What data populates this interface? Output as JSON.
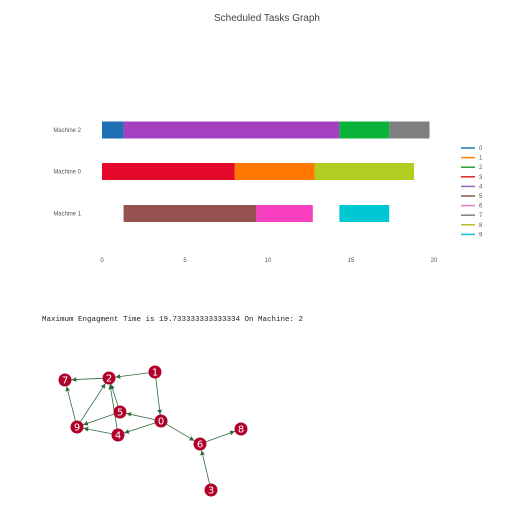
{
  "chart_data": [
    {
      "type": "gantt",
      "title": "Scheduled Tasks Graph",
      "xlabel": "",
      "ylabel": "",
      "xlim": [
        0,
        20
      ],
      "x_ticks": [
        0,
        5,
        10,
        15,
        20
      ],
      "rows": [
        "Machine 1",
        "Machine 0",
        "Machine 2"
      ],
      "legend": {
        "placement": "right",
        "entries": [
          {
            "label": "0",
            "color": "#1f77b4"
          },
          {
            "label": "1",
            "color": "#ff7f0e"
          },
          {
            "label": "2",
            "color": "#2ca02c"
          },
          {
            "label": "3",
            "color": "#d62728"
          },
          {
            "label": "4",
            "color": "#9467bd"
          },
          {
            "label": "5",
            "color": "#8c564b"
          },
          {
            "label": "6",
            "color": "#e377c2"
          },
          {
            "label": "7",
            "color": "#7f7f7f"
          },
          {
            "label": "8",
            "color": "#bcbd22"
          },
          {
            "label": "9",
            "color": "#17becf"
          }
        ]
      },
      "tasks": [
        {
          "row": "Machine 2",
          "start": 0.0,
          "end": 1.3,
          "color": "#1f6fb4"
        },
        {
          "row": "Machine 2",
          "start": 1.3,
          "end": 14.3,
          "color": "#a340c0"
        },
        {
          "row": "Machine 2",
          "start": 14.3,
          "end": 17.3,
          "color": "#09b33a"
        },
        {
          "row": "Machine 2",
          "start": 17.3,
          "end": 19.73,
          "color": "#7f7f7f"
        },
        {
          "row": "Machine 0",
          "start": 0.0,
          "end": 8.0,
          "color": "#e60a2a"
        },
        {
          "row": "Machine 0",
          "start": 8.0,
          "end": 12.8,
          "color": "#ff7700"
        },
        {
          "row": "Machine 0",
          "start": 12.8,
          "end": 18.8,
          "color": "#b2cc22"
        },
        {
          "row": "Machine 1",
          "start": 1.3,
          "end": 9.3,
          "color": "#955250"
        },
        {
          "row": "Machine 1",
          "start": 9.3,
          "end": 12.7,
          "color": "#f73fc0"
        },
        {
          "row": "Machine 1",
          "start": 14.3,
          "end": 17.3,
          "color": "#00c8d2"
        }
      ]
    },
    {
      "type": "network",
      "nodes": [
        "0",
        "1",
        "2",
        "3",
        "4",
        "5",
        "6",
        "7",
        "8",
        "9"
      ],
      "node_color": "#b0002a",
      "edge_color": "#2e6b3d",
      "edges": [
        [
          "1",
          "2"
        ],
        [
          "2",
          "7"
        ],
        [
          "9",
          "7"
        ],
        [
          "1",
          "0"
        ],
        [
          "0",
          "5"
        ],
        [
          "0",
          "4"
        ],
        [
          "0",
          "6"
        ],
        [
          "6",
          "8"
        ],
        [
          "3",
          "6"
        ],
        [
          "4",
          "9"
        ],
        [
          "4",
          "2"
        ],
        [
          "5",
          "9"
        ],
        [
          "9",
          "2"
        ],
        [
          "5",
          "2"
        ]
      ]
    }
  ],
  "caption": "Maximum Engagment Time is 19.733333333333334 On Machine: 2"
}
